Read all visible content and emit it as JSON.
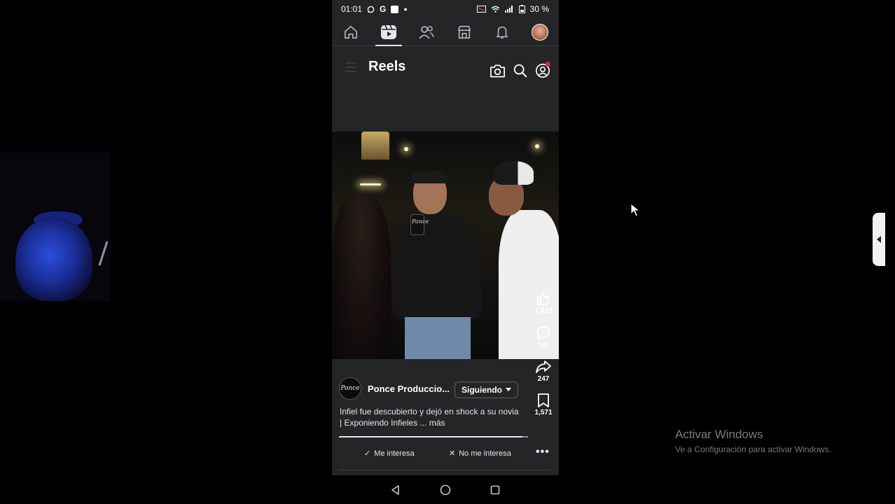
{
  "status_bar": {
    "time": "01:01",
    "left_icons": [
      "whatsapp-icon",
      "google-icon",
      "square-icon",
      "dot-icon"
    ],
    "battery": "30 %"
  },
  "nav_tabs": [
    {
      "name": "home-tab",
      "icon": "home-icon",
      "active": false
    },
    {
      "name": "reels-tab",
      "icon": "reels-icon",
      "active": true
    },
    {
      "name": "friends-tab",
      "icon": "friends-icon",
      "active": false
    },
    {
      "name": "marketplace-tab",
      "icon": "marketplace-icon",
      "active": false
    },
    {
      "name": "notifications-tab",
      "icon": "bell-icon",
      "active": false
    },
    {
      "name": "profile-tab",
      "icon": "avatar",
      "active": false
    }
  ],
  "header": {
    "title": "Reels",
    "icons": [
      "camera-icon",
      "search-icon",
      "profile-icon"
    ]
  },
  "reel": {
    "mic_logo": "Ponce",
    "likes": "7,623",
    "comments": "146",
    "shares": "247",
    "saves": "1,571",
    "author": "Ponce Produccio...",
    "author_avatar_text": "Ponce",
    "follow_label": "Siguiendo",
    "caption": "Infiel fue descubierto y dejó en shock a su novia | Exponiendo Infieles ... más",
    "progress": 0.97
  },
  "feedback": {
    "interested": "Me interesa",
    "not_interested": "No me interesa"
  },
  "windows_watermark": {
    "title": "Activar Windows",
    "subtitle": "Ve a Configuración para activar Windows."
  },
  "colors": {
    "surface": "#242526",
    "background": "#000000",
    "notification_dot": "#e41e3f"
  }
}
